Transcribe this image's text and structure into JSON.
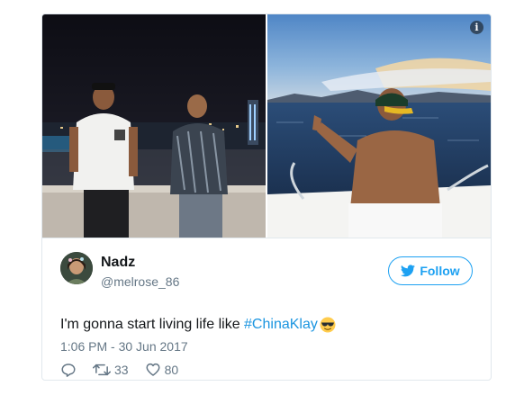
{
  "tweet": {
    "author": {
      "display_name": "Nadz",
      "handle": "@melrose_86",
      "avatar_icon": "profile-avatar"
    },
    "follow_label": "Follow",
    "text_prefix": "I'm gonna start living life like ",
    "hashtag": "#ChinaKlay",
    "emoji": "smiling-face-with-sunglasses",
    "timestamp": "1:06 PM - 30 Jun 2017",
    "retweets": "33",
    "likes": "80"
  },
  "media": {
    "info_glyph": "i",
    "photo_left": "two men on rooftop at night with city skyline",
    "photo_right": "man in cap on boat facing sea and mountains"
  },
  "colors": {
    "twitter_blue": "#1da1f2",
    "hashtag_blue": "#1b95e0",
    "text": "#14171a",
    "muted": "#657786",
    "border": "#e1e8ed"
  }
}
